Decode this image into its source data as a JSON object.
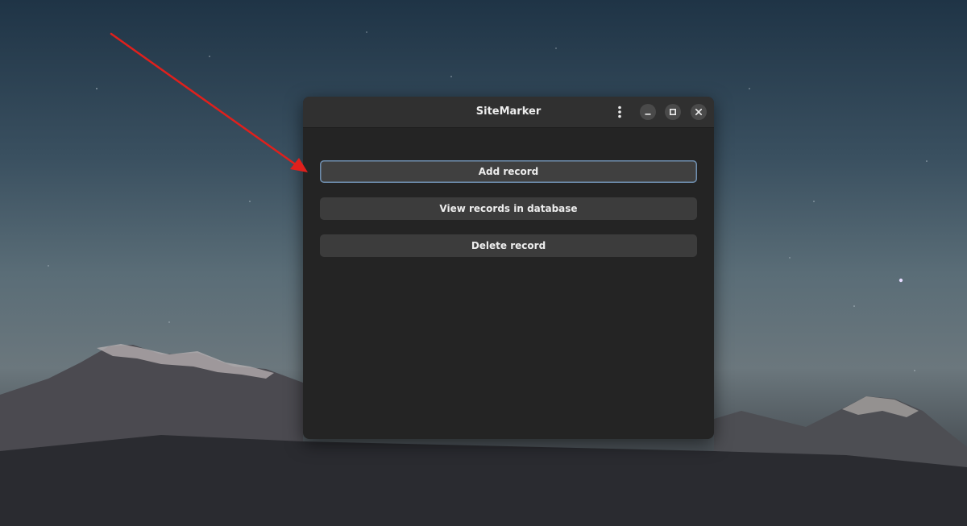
{
  "window": {
    "title": "SiteMarker"
  },
  "buttons": {
    "add": "Add record",
    "view": "View records in database",
    "delete": "Delete record"
  },
  "titlebar_controls": {
    "menu_icon": "vertical-dots-icon",
    "minimize_icon": "minimize-icon",
    "maximize_icon": "maximize-icon",
    "close_icon": "close-icon"
  },
  "colors": {
    "window_bg": "#242424",
    "titlebar_bg": "#303030",
    "button_bg": "#3c3c3c",
    "focus_ring": "#6f8fb0",
    "annotation_arrow": "#e0201c"
  }
}
